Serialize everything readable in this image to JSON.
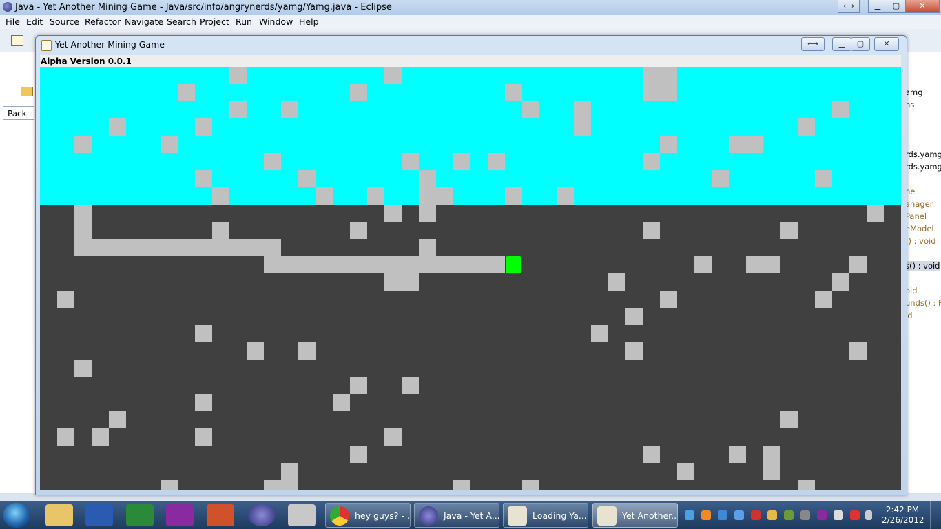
{
  "eclipse": {
    "title": "Java - Yet Another Mining Game - Java/src/info/angrynerds/yamg/Yamg.java - Eclipse",
    "menu": [
      "File",
      "Edit",
      "Source",
      "Refactor",
      "Navigate",
      "Search",
      "Project",
      "Run",
      "Window",
      "Help"
    ],
    "left_tab": "Pack",
    "outline_items": [
      "amg",
      "ns",
      "rds.yamg",
      "rds.yamg",
      "he",
      "anager",
      "Panel",
      "eModel",
      "() : void",
      "s() : void",
      "oid",
      "unds() : F",
      "id"
    ]
  },
  "game_window": {
    "title": "Yet Another Mining Game",
    "version": "Alpha Version 0.0.1",
    "colors": {
      "sky": "#00ffff",
      "ground": "#404040",
      "rock": "#c0c0c0",
      "player": "#00ff00"
    },
    "grid": {
      "cols": 50,
      "rows": 25,
      "sky_rows": 8
    },
    "player": {
      "col": 27,
      "row": 11
    },
    "rocks": [
      [
        11,
        0
      ],
      [
        20,
        0
      ],
      [
        35,
        0
      ],
      [
        36,
        0
      ],
      [
        8,
        1
      ],
      [
        18,
        1
      ],
      [
        27,
        1
      ],
      [
        35,
        1
      ],
      [
        36,
        1
      ],
      [
        11,
        2
      ],
      [
        14,
        2
      ],
      [
        28,
        2
      ],
      [
        31,
        2
      ],
      [
        46,
        2
      ],
      [
        4,
        3
      ],
      [
        9,
        3
      ],
      [
        31,
        3
      ],
      [
        44,
        3
      ],
      [
        2,
        4
      ],
      [
        7,
        4
      ],
      [
        36,
        4
      ],
      [
        40,
        4
      ],
      [
        41,
        4
      ],
      [
        13,
        5
      ],
      [
        21,
        5
      ],
      [
        24,
        5
      ],
      [
        26,
        5
      ],
      [
        35,
        5
      ],
      [
        9,
        6
      ],
      [
        15,
        6
      ],
      [
        22,
        6
      ],
      [
        39,
        6
      ],
      [
        45,
        6
      ],
      [
        10,
        7
      ],
      [
        16,
        7
      ],
      [
        19,
        7
      ],
      [
        22,
        7
      ],
      [
        23,
        7
      ],
      [
        27,
        7
      ],
      [
        30,
        7
      ],
      [
        2,
        8
      ],
      [
        20,
        8
      ],
      [
        22,
        8
      ],
      [
        48,
        8
      ],
      [
        2,
        9
      ],
      [
        10,
        9
      ],
      [
        18,
        9
      ],
      [
        35,
        9
      ],
      [
        43,
        9
      ],
      [
        2,
        10
      ],
      [
        3,
        10
      ],
      [
        4,
        10
      ],
      [
        5,
        10
      ],
      [
        6,
        10
      ],
      [
        7,
        10
      ],
      [
        8,
        10
      ],
      [
        9,
        10
      ],
      [
        10,
        10
      ],
      [
        11,
        10
      ],
      [
        12,
        10
      ],
      [
        13,
        10
      ],
      [
        22,
        10
      ],
      [
        13,
        11
      ],
      [
        14,
        11
      ],
      [
        15,
        11
      ],
      [
        16,
        11
      ],
      [
        17,
        11
      ],
      [
        18,
        11
      ],
      [
        19,
        11
      ],
      [
        20,
        11
      ],
      [
        21,
        11
      ],
      [
        22,
        11
      ],
      [
        23,
        11
      ],
      [
        24,
        11
      ],
      [
        25,
        11
      ],
      [
        26,
        11
      ],
      [
        38,
        11
      ],
      [
        41,
        11
      ],
      [
        42,
        11
      ],
      [
        47,
        11
      ],
      [
        20,
        12
      ],
      [
        21,
        12
      ],
      [
        33,
        12
      ],
      [
        46,
        12
      ],
      [
        1,
        13
      ],
      [
        36,
        13
      ],
      [
        45,
        13
      ],
      [
        34,
        14
      ],
      [
        9,
        15
      ],
      [
        32,
        15
      ],
      [
        12,
        16
      ],
      [
        15,
        16
      ],
      [
        34,
        16
      ],
      [
        47,
        16
      ],
      [
        2,
        17
      ],
      [
        18,
        18
      ],
      [
        21,
        18
      ],
      [
        9,
        19
      ],
      [
        17,
        19
      ],
      [
        4,
        20
      ],
      [
        43,
        20
      ],
      [
        1,
        21
      ],
      [
        3,
        21
      ],
      [
        9,
        21
      ],
      [
        20,
        21
      ],
      [
        18,
        22
      ],
      [
        35,
        22
      ],
      [
        40,
        22
      ],
      [
        42,
        22
      ],
      [
        14,
        23
      ],
      [
        37,
        23
      ],
      [
        42,
        23
      ],
      [
        7,
        24
      ],
      [
        13,
        24
      ],
      [
        14,
        24
      ],
      [
        24,
        24
      ],
      [
        28,
        24
      ],
      [
        44,
        24
      ]
    ]
  },
  "taskbar": {
    "tasks": [
      "hey guys? - ...",
      "Java - Yet A...",
      "Loading Ya...",
      "Yet Another..."
    ],
    "clock_time": "2:42 PM",
    "clock_date": "2/26/2012"
  }
}
